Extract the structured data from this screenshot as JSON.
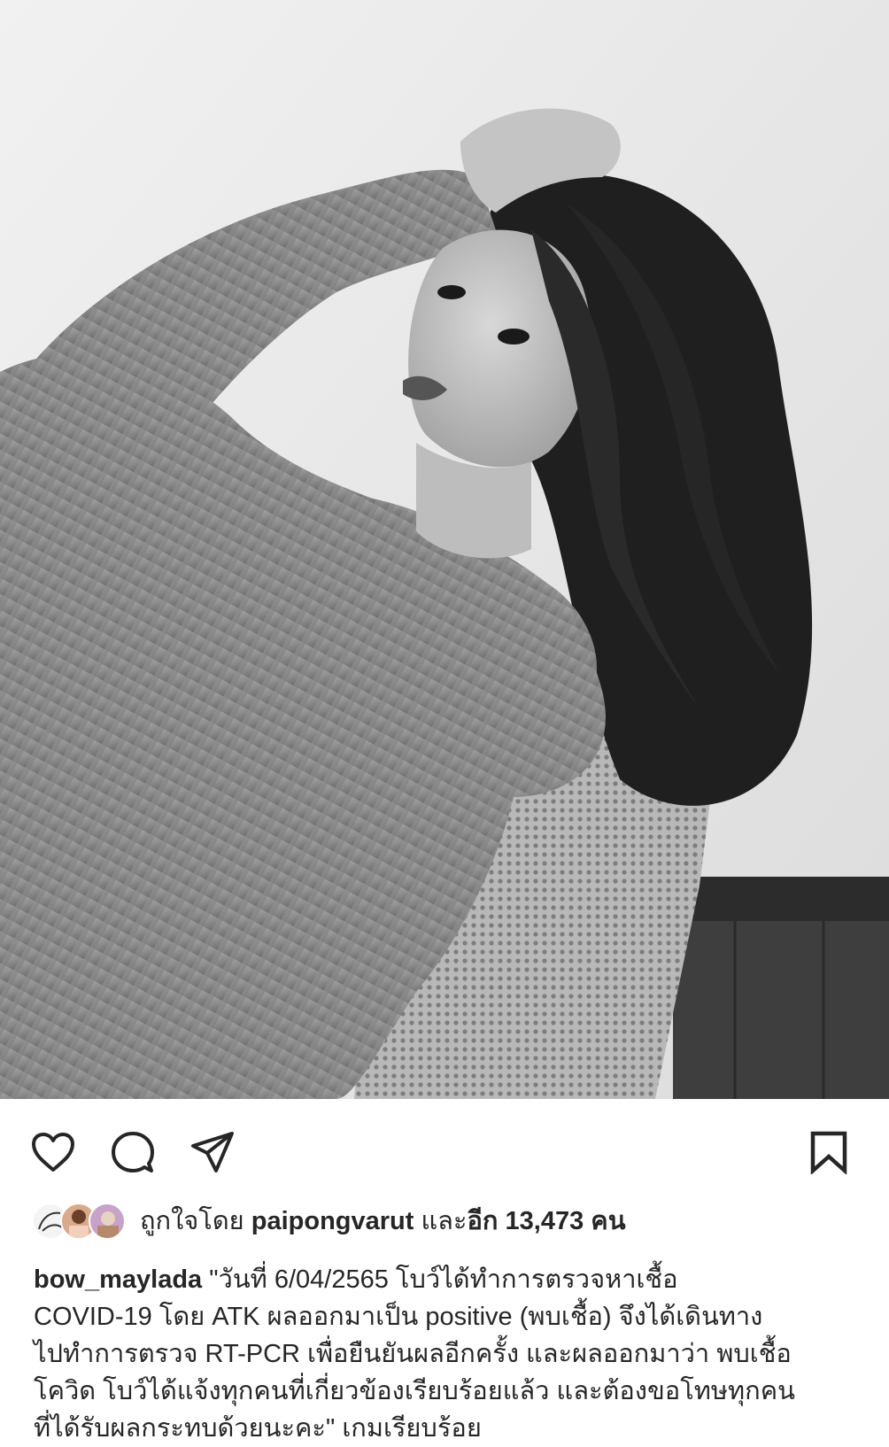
{
  "post": {
    "image": {
      "subject": "black-and-white-portrait"
    },
    "actions": {
      "like_icon": "heart-icon",
      "comment_icon": "comment-icon",
      "share_icon": "send-icon",
      "save_icon": "bookmark-icon"
    },
    "likes": {
      "prefix": "ถูกใจโดย",
      "user": "paipongvarut",
      "middle": "และ",
      "count_text": "อีก 13,473 คน"
    },
    "caption": {
      "username": "bow_maylada",
      "lines": [
        "\"วันที่ 6/04/2565 โบว์ได้ทำการตรวจหาเชื้อ",
        "COVID-19 โดย ATK ผลออกมาเป็น positive (พบเชื้อ) จึงได้เดินทาง",
        "ไปทำการตรวจ RT-PCR เพื่อยืนยันผลอีกครั้ง และผลออกมาว่า พบเชื้อ",
        "โควิด โบว์ได้แจ้งทุกคนที่เกี่ยวข้องเรียบร้อยแล้ว และต้องขอโทษทุกคน",
        "ที่ได้รับผลกระทบด้วยนะคะ\" เกมเรียบร้อย"
      ]
    }
  }
}
